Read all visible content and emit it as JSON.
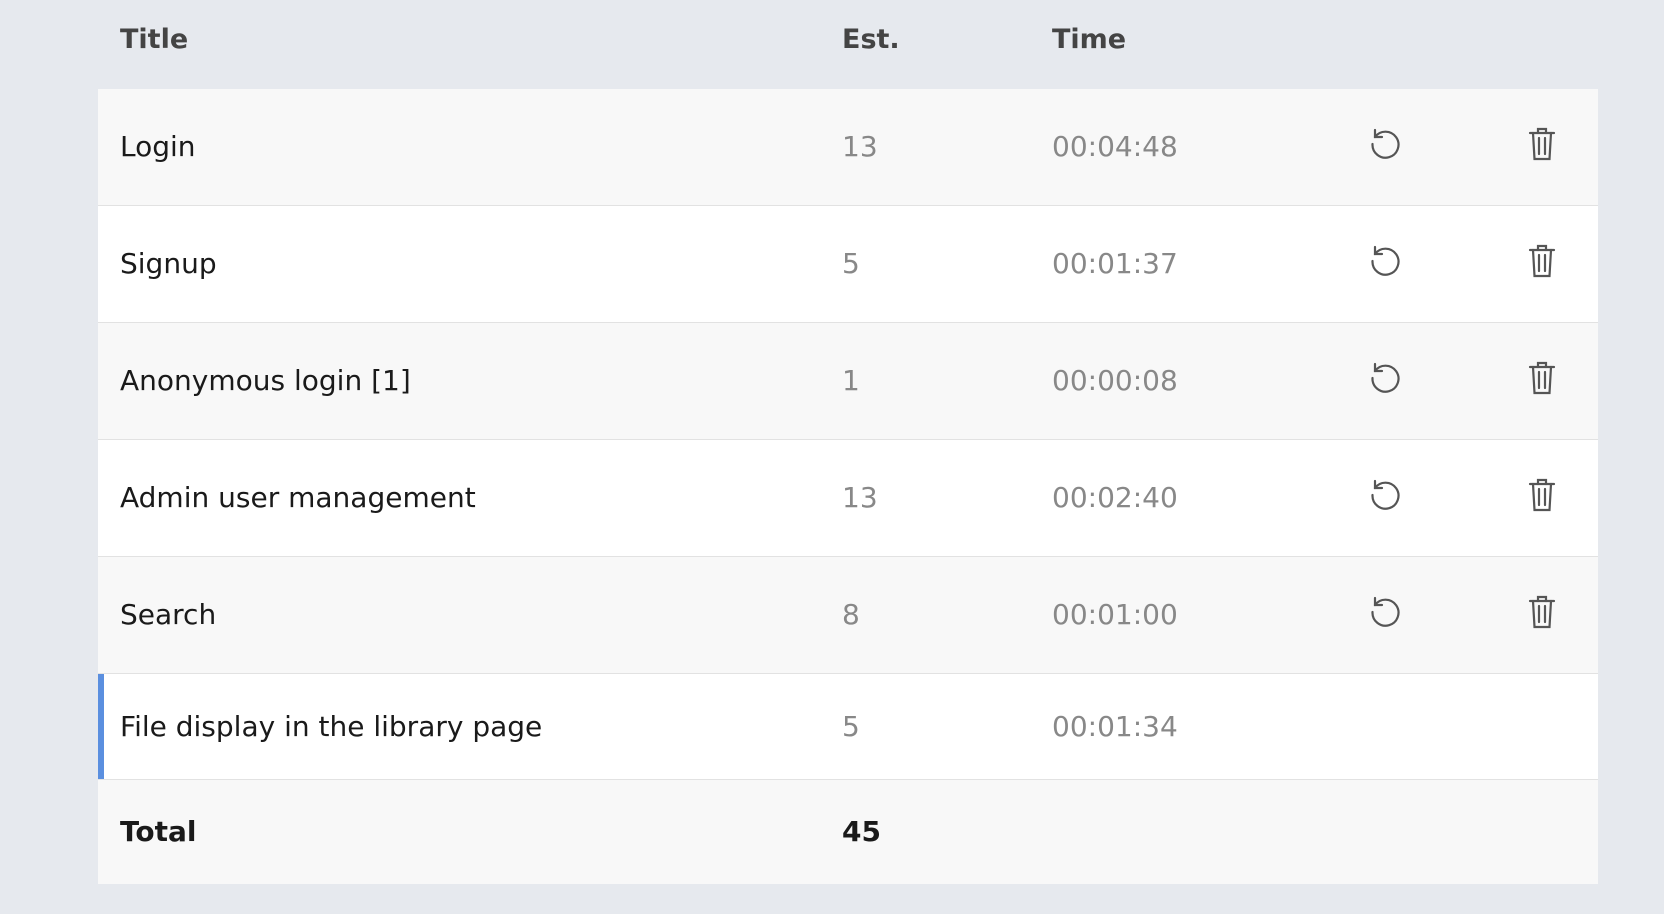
{
  "table": {
    "headers": {
      "title": "Title",
      "est": "Est.",
      "time": "Time"
    },
    "rows": [
      {
        "title": "Login",
        "est": "13",
        "time": "00:04:48",
        "actions": [
          "reset-icon",
          "trash-icon"
        ]
      },
      {
        "title": "Signup",
        "est": "5",
        "time": "00:01:37",
        "actions": [
          "reset-icon",
          "trash-icon"
        ]
      },
      {
        "title": "Anonymous login [1]",
        "est": "1",
        "time": "00:00:08",
        "actions": [
          "reset-icon",
          "trash-icon"
        ]
      },
      {
        "title": "Admin user management",
        "est": "13",
        "time": "00:02:40",
        "actions": [
          "reset-icon",
          "trash-icon"
        ]
      },
      {
        "title": "Search",
        "est": "8",
        "time": "00:01:00",
        "actions": [
          "reset-icon",
          "trash-icon"
        ]
      },
      {
        "title": "File display in the library page",
        "est": "5",
        "time": "00:01:34",
        "actions": [],
        "active": true
      }
    ],
    "total": {
      "label": "Total",
      "value": "45"
    }
  },
  "colors": {
    "background": "#e6e9ee",
    "active_indicator": "#5b8fdf",
    "muted_text": "#888888",
    "primary_text": "#1a1a1a"
  }
}
